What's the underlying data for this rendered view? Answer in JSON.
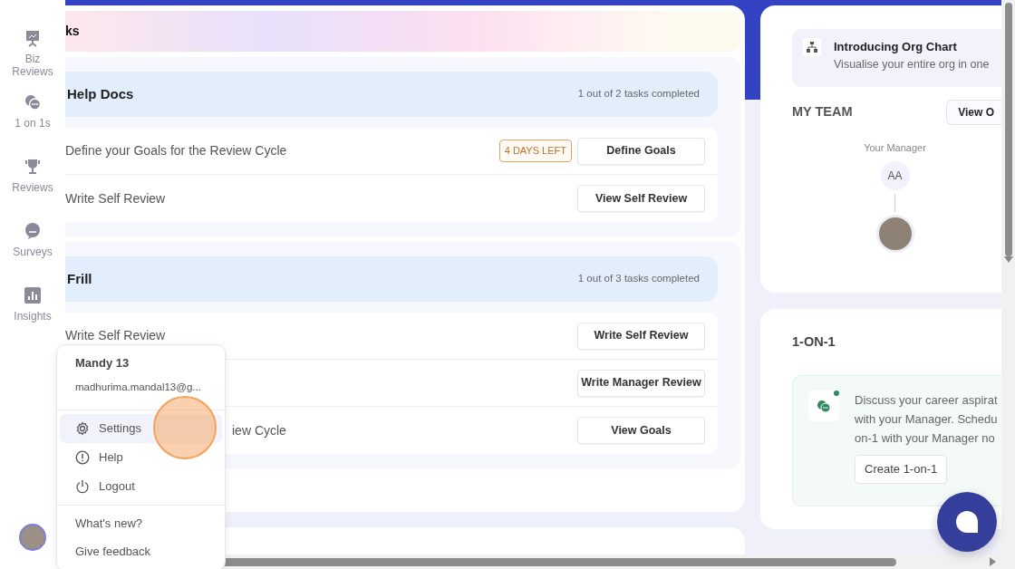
{
  "sidebar": {
    "items": [
      {
        "kind": "presentation",
        "label": "Biz Reviews"
      },
      {
        "kind": "chat",
        "label": "1 on 1s"
      },
      {
        "kind": "trophy",
        "label": "Reviews"
      },
      {
        "kind": "survey",
        "label": "Surveys"
      },
      {
        "kind": "chart",
        "label": "Insights"
      }
    ]
  },
  "tasks_header": {
    "title": "ks"
  },
  "task_groups": [
    {
      "title": "Help Docs",
      "progress": "1 out of 2 tasks completed",
      "tasks": [
        {
          "label": "Define your Goals for the Review Cycle",
          "badge": "4 DAYS LEFT",
          "action": "Define Goals"
        },
        {
          "label": "Write Self Review",
          "action": "View Self Review"
        }
      ]
    },
    {
      "title": "Frill",
      "progress": "1 out of 3 tasks completed",
      "tasks": [
        {
          "label": "Write Self Review",
          "action": "Write Self Review"
        },
        {
          "action": "Write Manager Review"
        },
        {
          "label": "iew Cycle",
          "action": "View Goals"
        }
      ]
    }
  ],
  "org_chart_banner": {
    "title": "Introducing Org Chart",
    "text": "Visualise your entire org in one"
  },
  "my_team": {
    "title": "MY TEAM",
    "button": "View O",
    "manager_label": "Your Manager",
    "manager_initials": "AA"
  },
  "one_on_one": {
    "title": "1-ON-1",
    "lines": [
      "Discuss your career aspirat",
      "with your Manager. Schedu",
      "on-1 with your Manager no"
    ],
    "button": "Create 1-on-1"
  },
  "user_menu": {
    "name": "Mandy 13",
    "email": "madhurima.mandal13@g...",
    "items": [
      {
        "kind": "settings",
        "label": "Settings",
        "selected": true
      },
      {
        "kind": "help",
        "label": "Help",
        "selected": false
      },
      {
        "kind": "logout",
        "label": "Logout",
        "selected": false
      }
    ],
    "links": [
      "What's new?",
      "Give feedback"
    ]
  }
}
